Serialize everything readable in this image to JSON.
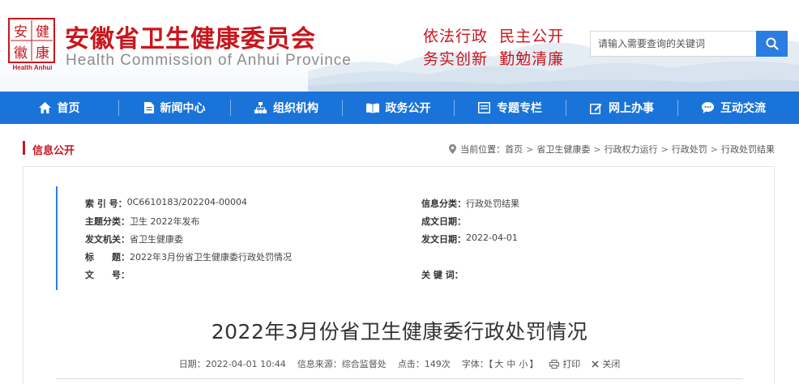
{
  "header": {
    "seal_chars": [
      "安",
      "健",
      "徽",
      "康"
    ],
    "seal_en": "Health Anhui",
    "title": "安徽省卫生健康委员会",
    "title_en": "Health Commission of Anhui Province",
    "slogan_line1": "依法行政  民主公开",
    "slogan_line2": "务实创新  勤勉清廉",
    "search": {
      "placeholder": "请输入需要查询的关键词",
      "value": ""
    },
    "brand_red": "#c8161d",
    "brand_blue": "#1a73d8"
  },
  "nav": {
    "items": [
      {
        "label": "首页",
        "icon": "home-icon"
      },
      {
        "label": "新闻中心",
        "icon": "document-icon"
      },
      {
        "label": "组织机构",
        "icon": "org-chart-icon"
      },
      {
        "label": "政务公开",
        "icon": "book-icon"
      },
      {
        "label": "专题专栏",
        "icon": "columns-icon"
      },
      {
        "label": "网上办事",
        "icon": "edit-icon"
      },
      {
        "label": "互动交流",
        "icon": "chat-icon"
      }
    ]
  },
  "section": {
    "title": "信息公开"
  },
  "breadcrumb": {
    "prefix": "当前位置：",
    "items": [
      "首页",
      "省卫生健康委",
      "行政权力运行",
      "行政处罚",
      "行政处罚结果"
    ]
  },
  "meta": {
    "index_key": "索 引 号：",
    "index_val": "0C6610183/202204-00004",
    "topic_key": "主题分类：",
    "topic_val": "卫生 2022年发布",
    "issuer_key": "发文机关：",
    "issuer_val": "省卫生健康委",
    "title_key": "标　　题：",
    "title_val": "2022年3月份省卫生健康委行政处罚情况",
    "docno_key": "文　　号：",
    "docno_val": "",
    "category_key": "信息分类：",
    "category_val": "行政处罚结果",
    "created_key": "成文日期：",
    "created_val": "",
    "published_key": "发文日期：",
    "published_val": "2022-04-01",
    "keywords_key": "关 键 词：",
    "keywords_val": ""
  },
  "article": {
    "title": "2022年3月份省卫生健康委行政处罚情况",
    "date_label": "日期：2022-04-01 10:44",
    "source_label": "信息来源：综合监督处",
    "views_label": "点击：149次",
    "font_label": "字体：【",
    "font_large": "大",
    "font_medium": "中",
    "font_small": "小",
    "font_end": "】",
    "print_label": "打印",
    "close_label": "关闭"
  }
}
